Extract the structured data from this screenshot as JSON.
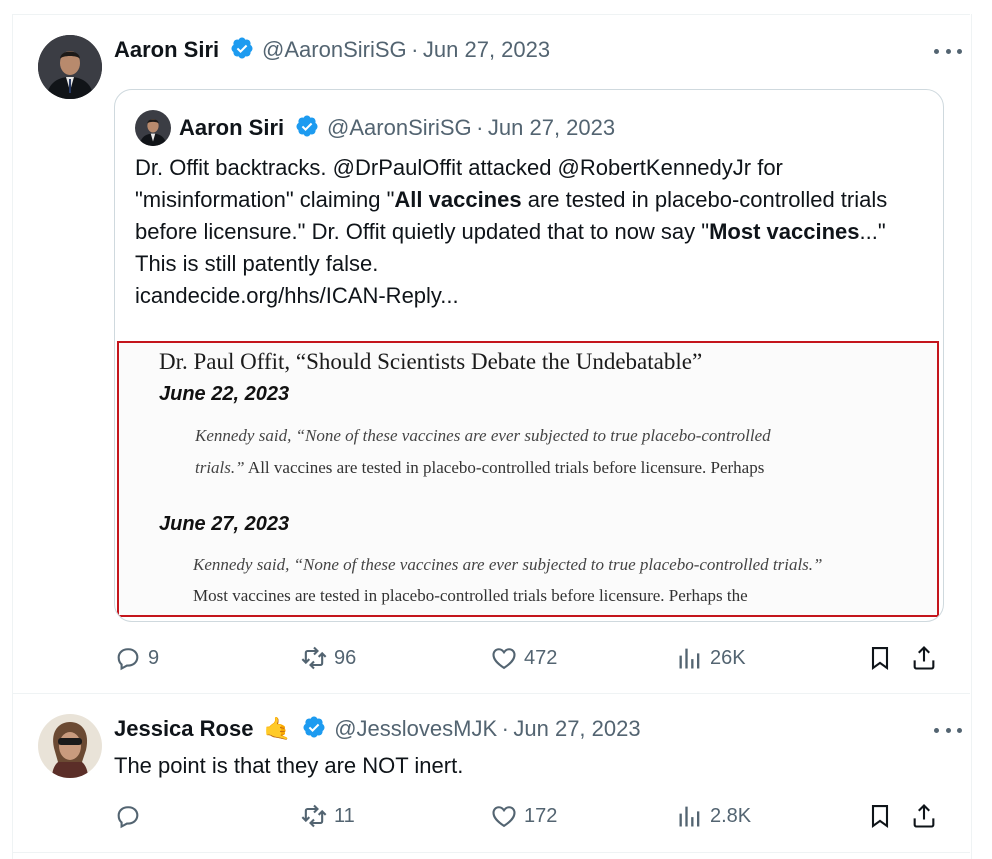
{
  "main_tweet": {
    "author": "Aaron Siri",
    "handle": "@AaronSiriSG",
    "separator": "·",
    "date": "Jun 27, 2023",
    "actions": {
      "replies": "9",
      "reposts": "96",
      "likes": "472",
      "views": "26K"
    }
  },
  "quoted_tweet": {
    "author": "Aaron Siri",
    "handle": "@AaronSiriSG",
    "separator": "·",
    "date": "Jun 27, 2023",
    "text": {
      "p1": "Dr. Offit backtracks. @DrPaulOffit attacked @RobertKennedyJr for \"misinformation\" claiming \"",
      "b1": "All vaccines",
      "p2": " are tested in placebo-controlled trials before licensure.\" Dr. Offit quietly updated that to now say \"",
      "b2": "Most vaccines",
      "p3": "...\" This is still patently false.",
      "link": "icandecide.org/hhs/ICAN-Reply..."
    },
    "image": {
      "title": "Dr. Paul Offit, “Should Scientists Debate the Undebatable”",
      "date1": "June 22, 2023",
      "line1": "Kennedy said, “None of these vaccines are ever subjected to true placebo-controlled",
      "line2_it": "trials.”",
      "line2": " All vaccines are tested in placebo-controlled trials before licensure. Perhaps",
      "date2": "June 27, 2023",
      "line3": "Kennedy said, “None of these vaccines are ever subjected to true placebo-controlled trials.”",
      "line4": "Most vaccines are tested in placebo-controlled trials before licensure. Perhaps the"
    }
  },
  "reply_tweet": {
    "author": "Jessica Rose",
    "emoji": "🤙",
    "handle": "@JesslovesMJK",
    "separator": "·",
    "date": "Jun 27, 2023",
    "text": "The point is that they are NOT inert.",
    "actions": {
      "replies": "",
      "reposts": "11",
      "likes": "172",
      "views": "2.8K"
    }
  },
  "colors": {
    "verified": "#1d9bf0",
    "muted": "#536471",
    "border": "#cfd9de",
    "highlight_box": "#c4151c"
  }
}
